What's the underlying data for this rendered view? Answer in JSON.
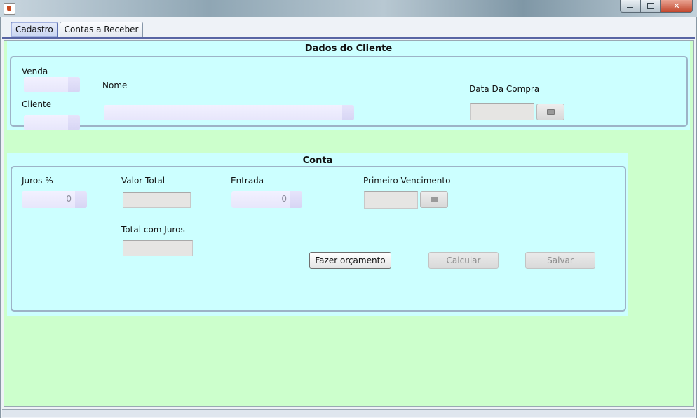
{
  "tabs": [
    "Cadastro",
    "Contas a Receber"
  ],
  "dados_cliente": {
    "title": "Dados do Cliente",
    "venda_label": "Venda",
    "cliente_label": "Cliente",
    "nome_label": "Nome",
    "data_compra_label": "Data Da Compra"
  },
  "conta": {
    "title": "Conta",
    "juros_label": "Juros %",
    "juros_value": "0",
    "valor_total_label": "Valor Total",
    "entrada_label": "Entrada",
    "entrada_value": "0",
    "primeiro_vencimento_label": "Primeiro Vencimento",
    "total_com_juros_label": "Total com Juros",
    "fazer_orcamento": "Fazer orçamento",
    "calcular": "Calcular",
    "salvar": "Salvar"
  },
  "colors": {
    "panel_bg": "#ccffcc",
    "group_bg": "#ccffff",
    "tab_underline": "#5865a4"
  }
}
